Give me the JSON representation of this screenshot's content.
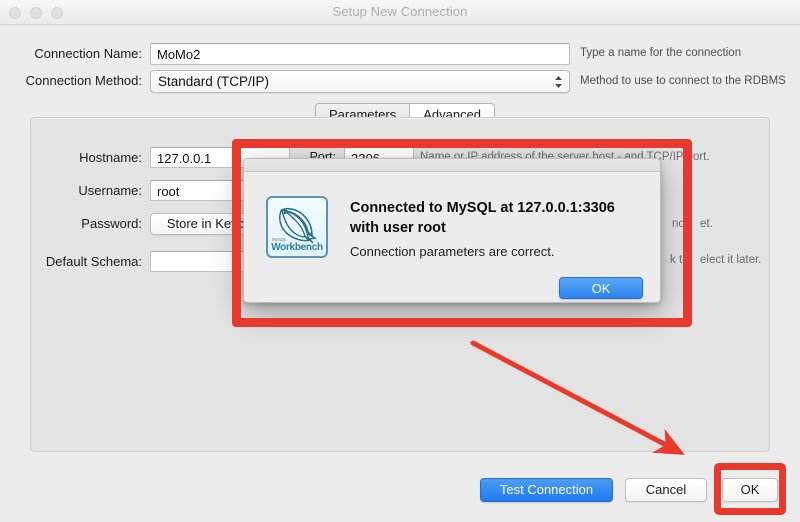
{
  "window": {
    "title": "Setup New Connection",
    "controls": [
      "close",
      "minimize",
      "maximize"
    ]
  },
  "form": {
    "connection_name": {
      "label": "Connection Name:",
      "value": "MoMo2",
      "hint": "Type a name for the connection"
    },
    "connection_method": {
      "label": "Connection Method:",
      "value": "Standard (TCP/IP)",
      "hint": "Method to use to connect to the RDBMS"
    }
  },
  "tabs": [
    {
      "label": "Parameters",
      "active": false
    },
    {
      "label": "Advanced",
      "active": true
    }
  ],
  "parameters": {
    "hostname": {
      "label": "Hostname:",
      "value": "127.0.0.1"
    },
    "port": {
      "label": "Port:",
      "value": "3306"
    },
    "username": {
      "label": "Username:",
      "value": "root"
    },
    "password": {
      "label": "Password:",
      "value": "Store in Keychain ..."
    },
    "default_schema": {
      "label": "Default Schema:",
      "value": ""
    },
    "hints": {
      "host_port": "Name or IP address of the server host - and TCP/IP port.",
      "port_tail": "ort.",
      "password_tail_a": "not",
      "password_tail_b": "et.",
      "schema_tail_a": "k to",
      "schema_tail_b": "elect it later."
    }
  },
  "footer": {
    "test_connection": "Test Connection",
    "cancel": "Cancel",
    "ok": "OK"
  },
  "alert": {
    "icon_name": "mysql-workbench-logo",
    "logo_brand": "MySQL",
    "logo_text": "Workbench",
    "heading": "Connected to MySQL at 127.0.0.1:3306 with user root",
    "message": "Connection parameters are correct.",
    "ok": "OK"
  },
  "annotations": {
    "color": "#e8392c",
    "boxes": [
      "alert-dialog-highlight",
      "ok-button-highlight"
    ],
    "arrow": "points from alert dialog to OK button"
  },
  "colors": {
    "accent_blue": "#2d83ef",
    "annotation_red": "#e8392c",
    "window_bg": "#ececec",
    "panel_bg": "#e3e3e3"
  }
}
